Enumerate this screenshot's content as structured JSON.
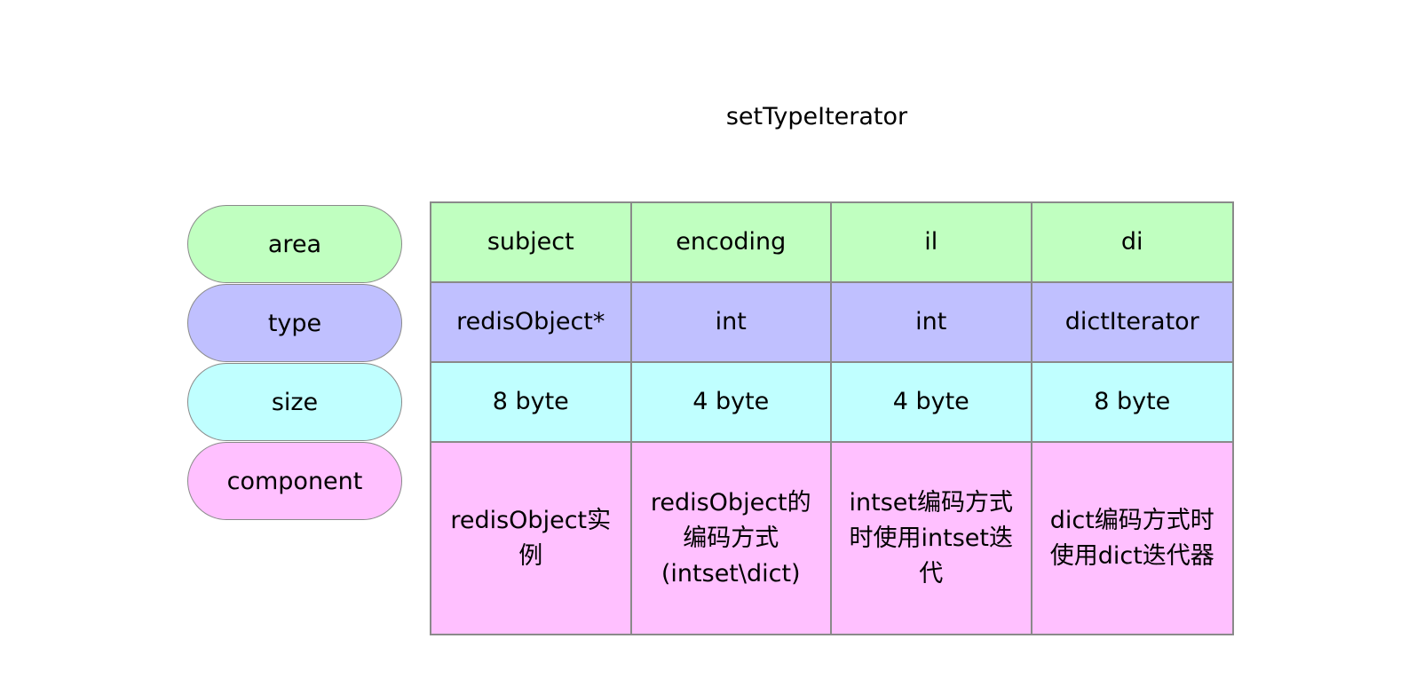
{
  "title": "setTypeIterator",
  "row_labels": {
    "area": "area",
    "type": "type",
    "size": "size",
    "component": "component"
  },
  "columns": [
    {
      "area": "subject",
      "type": "redisObject*",
      "size": "8 byte",
      "component": "redisObject实例"
    },
    {
      "area": "encoding",
      "type": "int",
      "size": "4 byte",
      "component": "redisObject的编码方式(intset\\dict)"
    },
    {
      "area": "il",
      "type": "int",
      "size": "4 byte",
      "component": "intset编码方式时使用intset迭代"
    },
    {
      "area": "di",
      "type": "dictIterator",
      "size": "8 byte",
      "component": "dict编码方式时使用dict迭代器"
    }
  ],
  "colors": {
    "area": "#c0ffc0",
    "type": "#c0c0ff",
    "size": "#c0ffff",
    "component": "#ffc0ff",
    "border": "#8a8a8a"
  }
}
